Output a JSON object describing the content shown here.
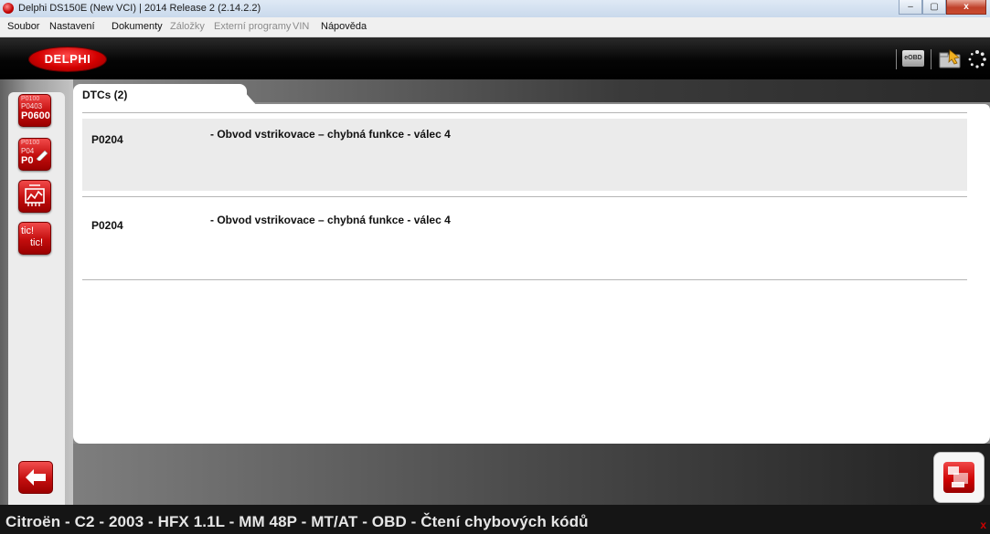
{
  "window": {
    "title": "Delphi DS150E (New VCI) | 2014 Release 2 (2.14.2.2)",
    "controls": {
      "minimize": "–",
      "maximize": "▢",
      "close": "x"
    }
  },
  "menu": [
    {
      "label": "Soubor",
      "enabled": true
    },
    {
      "label": "Nastavení",
      "enabled": true
    },
    {
      "label": "Dokumenty",
      "enabled": true
    },
    {
      "label": "Záložky",
      "enabled": false
    },
    {
      "label": "Externí programy",
      "enabled": false
    },
    {
      "label": "VIN",
      "enabled": false
    },
    {
      "label": "Nápověda",
      "enabled": true
    }
  ],
  "header": {
    "logo": "DELPHI",
    "eobd_label": "eOBD",
    "icons": [
      "eobd-icon",
      "folder-icon",
      "spinner-icon"
    ]
  },
  "tools": [
    {
      "name": "read-dtc-tool",
      "lines": [
        "P0100",
        "P0403",
        "P0600"
      ]
    },
    {
      "name": "erase-dtc-tool",
      "lines": [
        "P0100",
        "P04",
        "P0"
      ]
    },
    {
      "name": "live-data-tool",
      "icon": "engine-gauge-icon"
    },
    {
      "name": "actuator-test-tool",
      "lines": [
        "tic!",
        "tic!"
      ]
    }
  ],
  "tab": {
    "label": "DTCs (2)"
  },
  "dtcs": [
    {
      "code": "P0204",
      "description": "- Obvod vstrikovace – chybná funkce - válec 4"
    },
    {
      "code": "P0204",
      "description": "- Obvod vstrikovace – chybná funkce - válec 4"
    }
  ],
  "status": {
    "text": "Citroën - C2 - 2003 - HFX 1.1L - MM 48P - MT/AT - OBD - Čtení chybových kódů",
    "corner": "x"
  },
  "colors": {
    "accent": "#cc0000",
    "header": "#000000",
    "row_alt": "#ebebeb"
  }
}
